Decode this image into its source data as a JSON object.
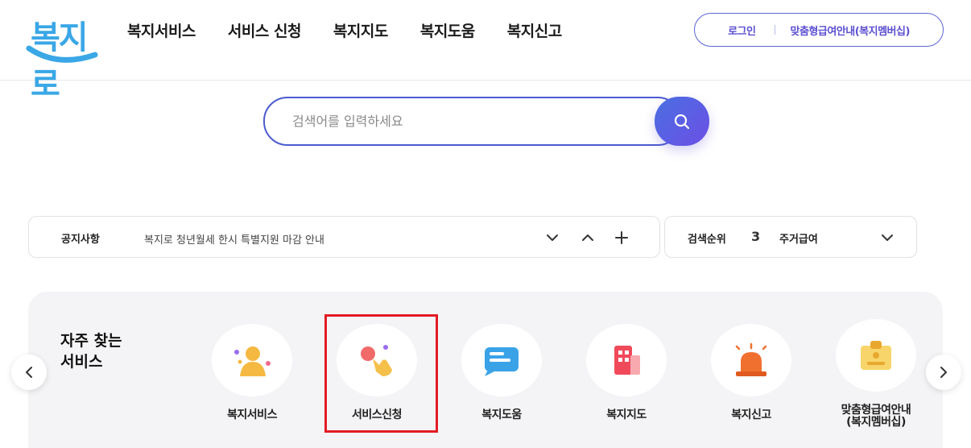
{
  "header": {
    "logo_text": "복지로",
    "nav": [
      "복지서비스",
      "서비스 신청",
      "복지지도",
      "복지도움",
      "복지신고"
    ],
    "login_label": "로그인",
    "custom_benefit_label": "맞춤형급여안내(복지멤버십)"
  },
  "search": {
    "placeholder": "검색어를 입력하세요"
  },
  "notice": {
    "label": "공지사항",
    "text": "복지로 청년월세 한시 특별지원 마감 안내"
  },
  "ranking": {
    "label": "검색순위",
    "rank": "3",
    "term": "주거급여"
  },
  "frequent": {
    "title": "자주 찾는\n서비스",
    "items": [
      {
        "label": "복지서비스",
        "icon": "person-icon"
      },
      {
        "label": "서비스신청",
        "icon": "tap-hand-icon"
      },
      {
        "label": "복지도움",
        "icon": "chat-icon"
      },
      {
        "label": "복지지도",
        "icon": "building-icon"
      },
      {
        "label": "복지신고",
        "icon": "siren-icon"
      },
      {
        "label": "맞춤형급여안내\n(복지멤버십)",
        "icon": "id-badge-icon"
      }
    ]
  },
  "colors": {
    "brand_blue": "#3aa7e6",
    "accent_purple": "#5b4fd1",
    "search_border": "#4c5bd0",
    "highlight_red": "#e31b23"
  }
}
